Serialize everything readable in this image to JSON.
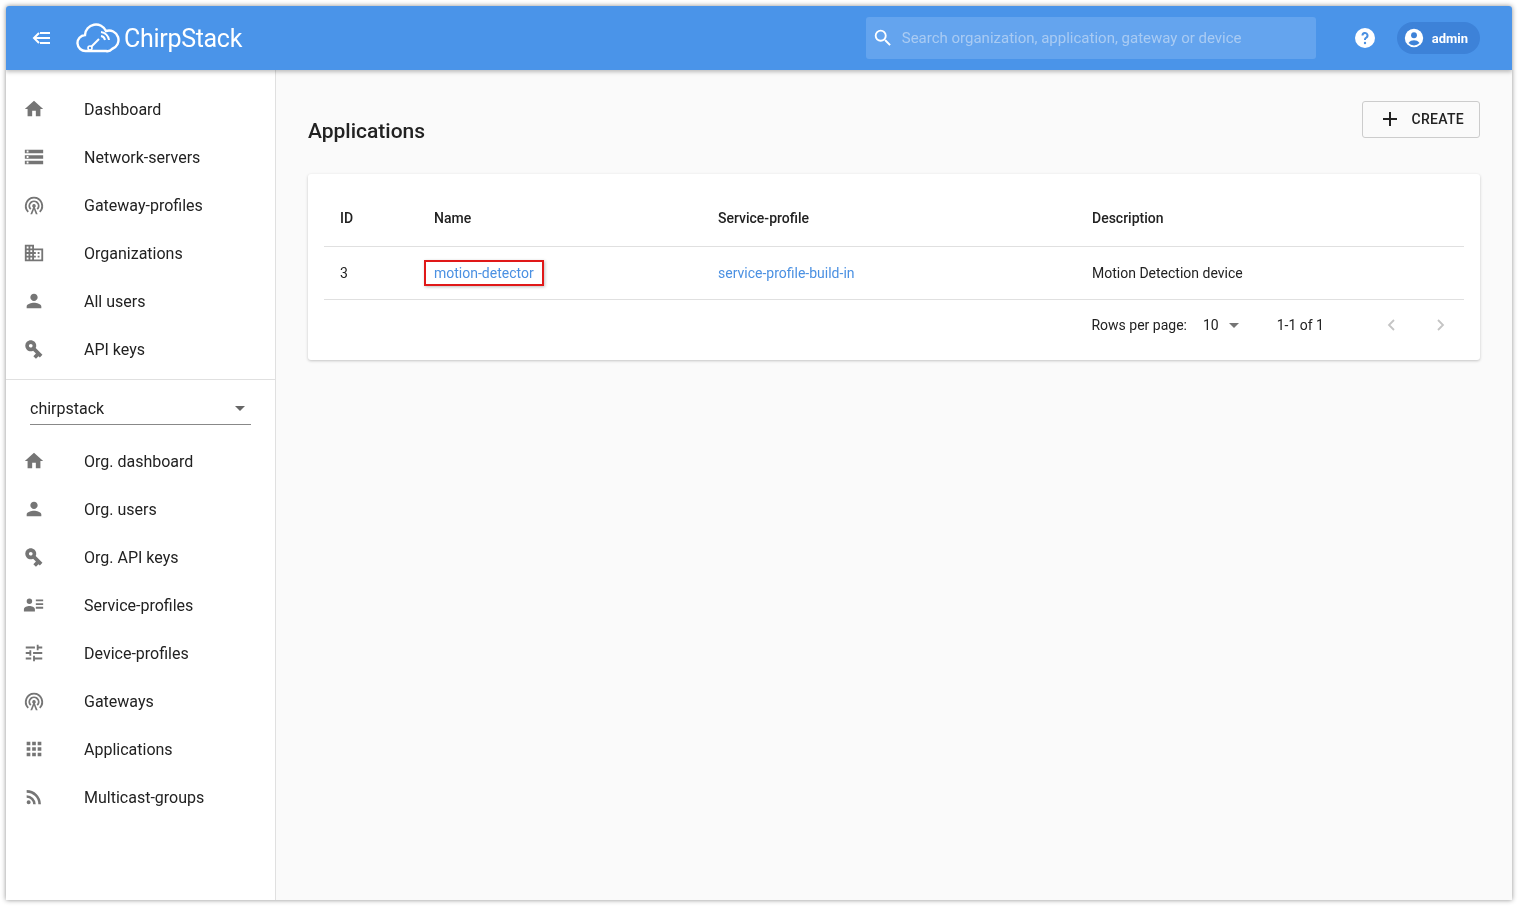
{
  "header": {
    "brand": "ChirpStack",
    "search": {
      "placeholder": "Search organization, application, gateway or device"
    },
    "user": "admin"
  },
  "sidebar": {
    "items": [
      {
        "label": "Dashboard"
      },
      {
        "label": "Network-servers"
      },
      {
        "label": "Gateway-profiles"
      },
      {
        "label": "Organizations"
      },
      {
        "label": "All users"
      },
      {
        "label": "API keys"
      }
    ],
    "organization_select": {
      "value": "chirpstack"
    },
    "org_items": [
      {
        "label": "Org. dashboard"
      },
      {
        "label": "Org. users"
      },
      {
        "label": "Org. API keys"
      },
      {
        "label": "Service-profiles"
      },
      {
        "label": "Device-profiles"
      },
      {
        "label": "Gateways"
      },
      {
        "label": "Applications"
      },
      {
        "label": "Multicast-groups"
      }
    ]
  },
  "page": {
    "title": "Applications",
    "create_button": "CREATE"
  },
  "table": {
    "columns": [
      "ID",
      "Name",
      "Service-profile",
      "Description"
    ],
    "rows": [
      {
        "id": "3",
        "name": "motion-detector",
        "name_highlighted": true,
        "service_profile": "service-profile-build-in",
        "description": "Motion Detection device"
      }
    ],
    "pagination": {
      "rows_per_page_label": "Rows per page:",
      "rows_per_page": "10",
      "range": "1-1 of 1"
    }
  }
}
